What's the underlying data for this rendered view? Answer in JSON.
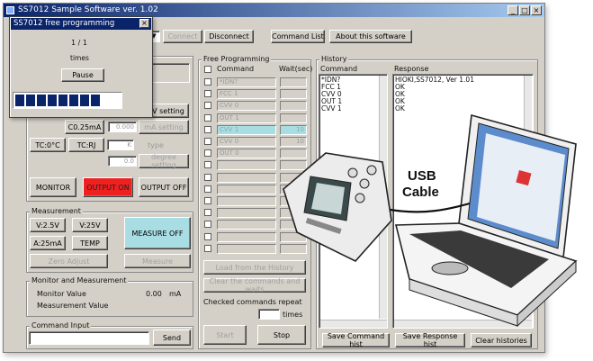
{
  "window": {
    "title": "SS7012 Sample Software ver. 1.02",
    "min": "_",
    "max": "□",
    "close": "×"
  },
  "toolbar": {
    "connect": "Connect",
    "disconnect": "Disconnect",
    "command_list": "Command List",
    "about": "About this software"
  },
  "dialog": {
    "title": "SS7012 free programming",
    "close": "×",
    "progress": "1 / 1",
    "unit": "times",
    "pause": "Pause",
    "progress_fraction": 0.6,
    "progress_segments": 8
  },
  "generator": {
    "v_setting": "V setting",
    "c_25ma": "C0.25mA",
    "c_value": "0.000",
    "ma_setting": "mA setting",
    "tc0c": "TC:0°C",
    "tcrj": "TC:RJ",
    "tc_select": "K",
    "tc_unit": "type",
    "tc_value": "0.0",
    "degree_setting": "degree setting",
    "monitor": "MONITOR",
    "output_on": "OUTPUT ON",
    "output_off": "OUTPUT OFF"
  },
  "measurement": {
    "title": "Measurement",
    "v25": "V:2.5V",
    "v25v": "V:25V",
    "a25ma": "A:25mA",
    "temp": "TEMP",
    "measure_off": "MEASURE OFF",
    "zero_adjust": "Zero Adjust",
    "measure": "Measure"
  },
  "monitor": {
    "title": "Monitor and Measurement",
    "monitor_label": "Monitor Value",
    "monitor_value": "0.00",
    "monitor_unit": "mA",
    "measure_label": "Measurement Value"
  },
  "command_input": {
    "title": "Command Input",
    "value": "",
    "send": "Send"
  },
  "free_prog": {
    "title": "Free Programming",
    "col_command": "Command",
    "col_wait": "Wait(sec)",
    "rows": [
      {
        "cmd": "*IDN?",
        "wait": "",
        "sel": false
      },
      {
        "cmd": "FCC 1",
        "wait": "",
        "sel": false
      },
      {
        "cmd": "CVV 0",
        "wait": "",
        "sel": false
      },
      {
        "cmd": "OUT 1",
        "wait": "",
        "sel": false
      },
      {
        "cmd": "CVV 1",
        "wait": "10",
        "sel": true
      },
      {
        "cmd": "CVV 0",
        "wait": "10",
        "sel": false
      },
      {
        "cmd": "OUT 0",
        "wait": "",
        "sel": false
      },
      {
        "cmd": "",
        "wait": "",
        "sel": false
      },
      {
        "cmd": "",
        "wait": "",
        "sel": false
      },
      {
        "cmd": "",
        "wait": "",
        "sel": false
      },
      {
        "cmd": "",
        "wait": "",
        "sel": false
      },
      {
        "cmd": "",
        "wait": "",
        "sel": false
      },
      {
        "cmd": "",
        "wait": "",
        "sel": false
      },
      {
        "cmd": "",
        "wait": "",
        "sel": false
      },
      {
        "cmd": "",
        "wait": "",
        "sel": false
      }
    ],
    "load": "Load from the History",
    "clear": "Clear the commands and waits",
    "repeat_label": "Checked commands repeat",
    "repeat_value": "",
    "times": "times",
    "start": "Start",
    "stop": "Stop"
  },
  "history": {
    "title": "History",
    "col_command": "Command",
    "col_response": "Response",
    "commands": [
      "*IDN?",
      "FCC 1",
      "CVV 0",
      "OUT 1",
      "CVV 1"
    ],
    "responses": [
      "HIOKI,SS7012, Ver 1.01",
      "OK",
      "OK",
      "OK",
      "OK"
    ],
    "save_command": "Save Command hist",
    "save_response": "Save Response hist",
    "clear": "Clear histories"
  },
  "overlay": {
    "usb_label_1": "USB",
    "usb_label_2": "Cable"
  }
}
